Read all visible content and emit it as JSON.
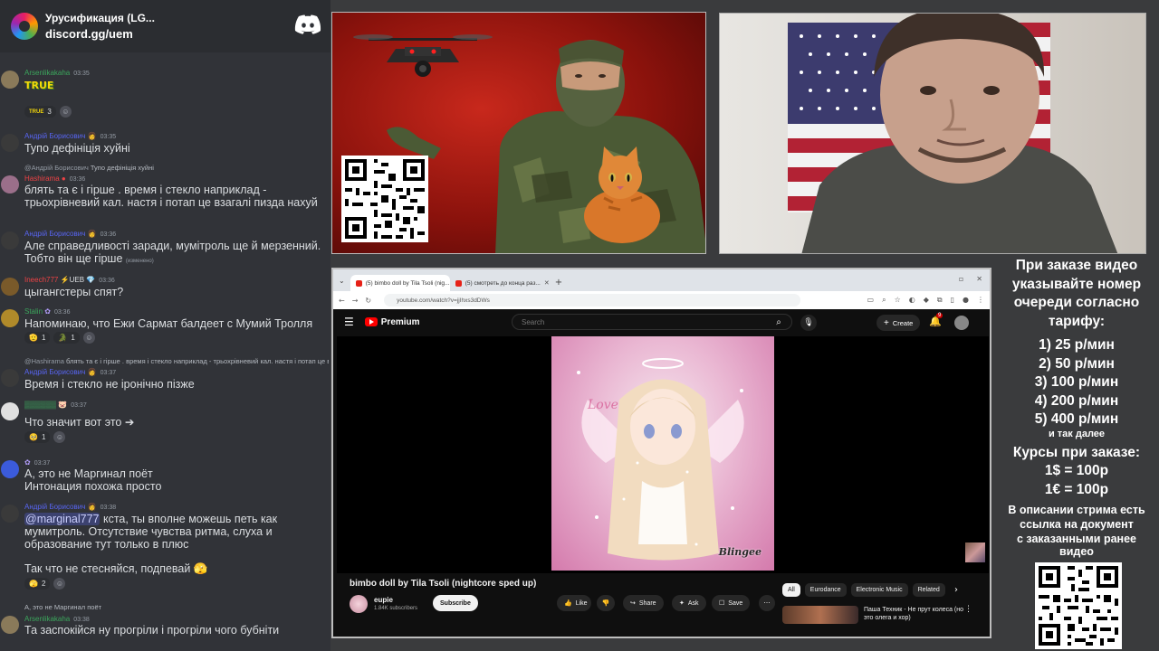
{
  "discord": {
    "server_name": "Урусификация (LG...",
    "invite": "discord.gg/uem",
    "messages": [
      {
        "author": "Arsenlikakaha",
        "author_color": "#3ba55c",
        "time": "03:35",
        "emote": "TRUE",
        "reactions": [
          {
            "emoji": "TRUE",
            "count": "3"
          }
        ]
      },
      {
        "author": "Андрій Борисович",
        "author_color": "#5865f2",
        "time": "03:35",
        "text": "Тупо дефініція хуйні"
      },
      {
        "reply_author": "@Андрій Борисович",
        "reply_text": "Тупо дефініція хуйні",
        "author": "Hashirama",
        "author_color": "#ed4245",
        "time": "03:36",
        "text": "блять та є і гірше . время і стекло наприклад - трьохрівневий кал. настя і потап це взагалі пизда нахуй"
      },
      {
        "author": "Андрій Борисович",
        "author_color": "#5865f2",
        "time": "03:36",
        "text": "Але справедливості заради, мумітроль ще й мерзенний. Тобто він ще гірше",
        "edited": "(изменено)"
      },
      {
        "author": "Ineech777",
        "author_color": "#ed4245",
        "tag": "UEB",
        "time": "03:36",
        "text": "цыгангстеры спят?"
      },
      {
        "author": "Stalin",
        "author_color": "#3ba55c",
        "time": "03:36",
        "text": "Напоминаю, что Ежи Сармат балдеет с Мумий Тролля",
        "reactions": [
          {
            "emoji": "🫡",
            "count": "1"
          },
          {
            "emoji": "🐊",
            "count": "1"
          }
        ]
      },
      {
        "reply_author": "@Hashirama",
        "reply_text": "блять та є і гірше . время і стекло наприклад - трьохрівневий кал. настя і потап це вз",
        "author": "Андрій Борисович",
        "author_color": "#5865f2",
        "time": "03:37",
        "text": "Время і стекло не іронічно пізже"
      },
      {
        "author": "",
        "time": "03:37",
        "text": "Что значит вот это ➔",
        "reactions": [
          {
            "emoji": "🥺",
            "count": "1"
          }
        ]
      },
      {
        "author": "",
        "time": "03:37",
        "text": "А, это не Маргинал поёт Интонация похожа просто"
      },
      {
        "author": "Андрій Борисович",
        "author_color": "#5865f2",
        "time": "03:38",
        "mention": "@marginal777",
        "text": " кста, ты вполне можешь петь как мумитроль. Отсутствие чувства ритма, слуха и образование тут только в плюс",
        "text2": "Так что не стесняйся, подпевай",
        "reactions": [
          {
            "emoji": "🫣",
            "count": "2"
          }
        ]
      },
      {
        "reply_author": "",
        "reply_text": "А, это не Маргинал поёт",
        "author": "Arsenlikakaha",
        "author_color": "#3ba55c",
        "time": "03:38",
        "text": "Та заспокійся ну прогріли і прогріли чого бубніти"
      }
    ]
  },
  "browser": {
    "tabs": [
      {
        "title": "(5) bimbo doll by Tila Tsoli (nig..."
      },
      {
        "title": "(5) смотреть до конца раз..."
      }
    ],
    "url": "youtube.com/watch?v=jjIhxs3dDWs",
    "youtube": {
      "brand": "Premium",
      "search_placeholder": "Search",
      "create_label": "Create",
      "notif_count": "9",
      "video_title": "bimbo doll by Tila Tsoli (nightcore sped up)",
      "channel": "eupie",
      "subscribers": "1.84K subscribers",
      "subscribe_label": "Subscribe",
      "like_label": "Like",
      "share_label": "Share",
      "ask_label": "Ask",
      "save_label": "Save",
      "chips": [
        "All",
        "Eurodance",
        "Electronic Music",
        "Related"
      ],
      "rec_title": "Паша Техник - Не прут колеса (но это олега и хор)",
      "watermark": "Blingee"
    }
  },
  "info": {
    "line1": "При заказе видео",
    "line2": "указывайте номер",
    "line3": "очереди согласно",
    "line4": "тарифу:",
    "t1": "1) 25 р/мин",
    "t2": "2) 50 р/мин",
    "t3": "3) 100 р/мин",
    "t4": "4) 200 р/мин",
    "t5": "5) 400 р/мин",
    "etc": "и так далее",
    "rates_title": "Курсы при заказе:",
    "rate1": "1$ = 100р",
    "rate2": "1€ = 100р",
    "desc1": "В описании стрима есть",
    "desc2": "ссылка на документ",
    "desc3": "с заказанными ранее",
    "desc4": "видео"
  }
}
